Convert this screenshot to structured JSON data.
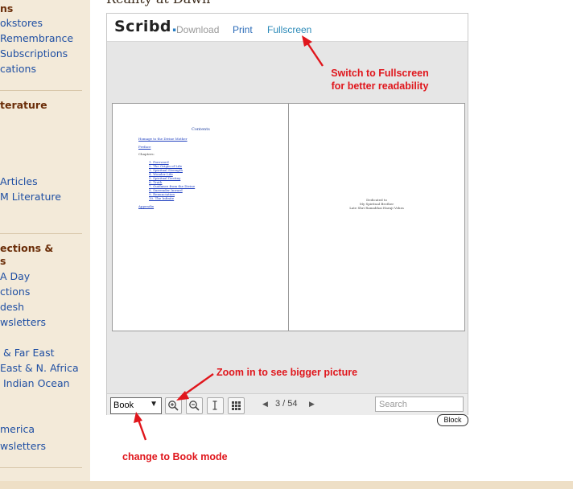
{
  "page": {
    "heading": "Reality at Dawn"
  },
  "sidebar": {
    "sections": [
      {
        "items": [
          "okstores",
          "Remembrance",
          "Subscriptions",
          "cations"
        ]
      },
      {
        "title": "terature",
        "items": [
          "Articles",
          "M Literature"
        ]
      },
      {
        "title": "ections &\ns",
        "items": [
          " A Day",
          "ctions",
          "desh",
          "wsletters",
          "& Far East",
          "East & N. Africa",
          "Indian Ocean",
          "merica",
          "wsletters"
        ]
      }
    ]
  },
  "viewer": {
    "logo": "Scribd",
    "logo_dot": ".",
    "toolbar": {
      "download": "Download",
      "print": "Print",
      "fullscreen": "Fullscreen"
    },
    "left_page": {
      "heading": "Contents",
      "links": [
        "Homage to the Divine Mother",
        "Preface"
      ],
      "chapters_label": "Chapters:",
      "chapters": [
        "1. Foreword",
        "2. The Origin of Life",
        "3. Spiritual Strength",
        "4. Wonder Life",
        "5. Spiritual Destiny",
        "6. Truth",
        "7. Guidance from the Divine",
        "8. Surrender Inward",
        "9. Renunciation",
        "10. The Infinite"
      ],
      "appendix": "Appendix"
    },
    "right_page": {
      "lines": [
        "Dedicated to",
        "My Spiritual Brother",
        "Late Shri Ramabhai Haraji Vohra"
      ]
    },
    "bottombar": {
      "mode": "Book",
      "page_current": "3",
      "page_total": "54",
      "page_counter": "3 / 54",
      "search_placeholder": "Search"
    },
    "badge": "Block"
  },
  "annotations": {
    "fullscreen_line1": "Switch to Fullscreen",
    "fullscreen_line2": "for better readability",
    "zoom": "Zoom in to see bigger picture",
    "book": "change to Book mode"
  },
  "colors": {
    "sidebar_bg": "#f3ead9",
    "sidebar_heading": "#6a2d08",
    "sidebar_link": "#1f4fa3",
    "annotation_red": "#e0161c",
    "fullscreen_link": "#2b8ab8"
  },
  "icons": {
    "zoom_in": "zoom-in-icon",
    "zoom_out": "zoom-out-icon",
    "text_select": "text-cursor-icon",
    "grid": "grid-view-icon",
    "prev": "triangle-left-icon",
    "next": "triangle-right-icon",
    "dropdown": "chevron-down-icon"
  }
}
